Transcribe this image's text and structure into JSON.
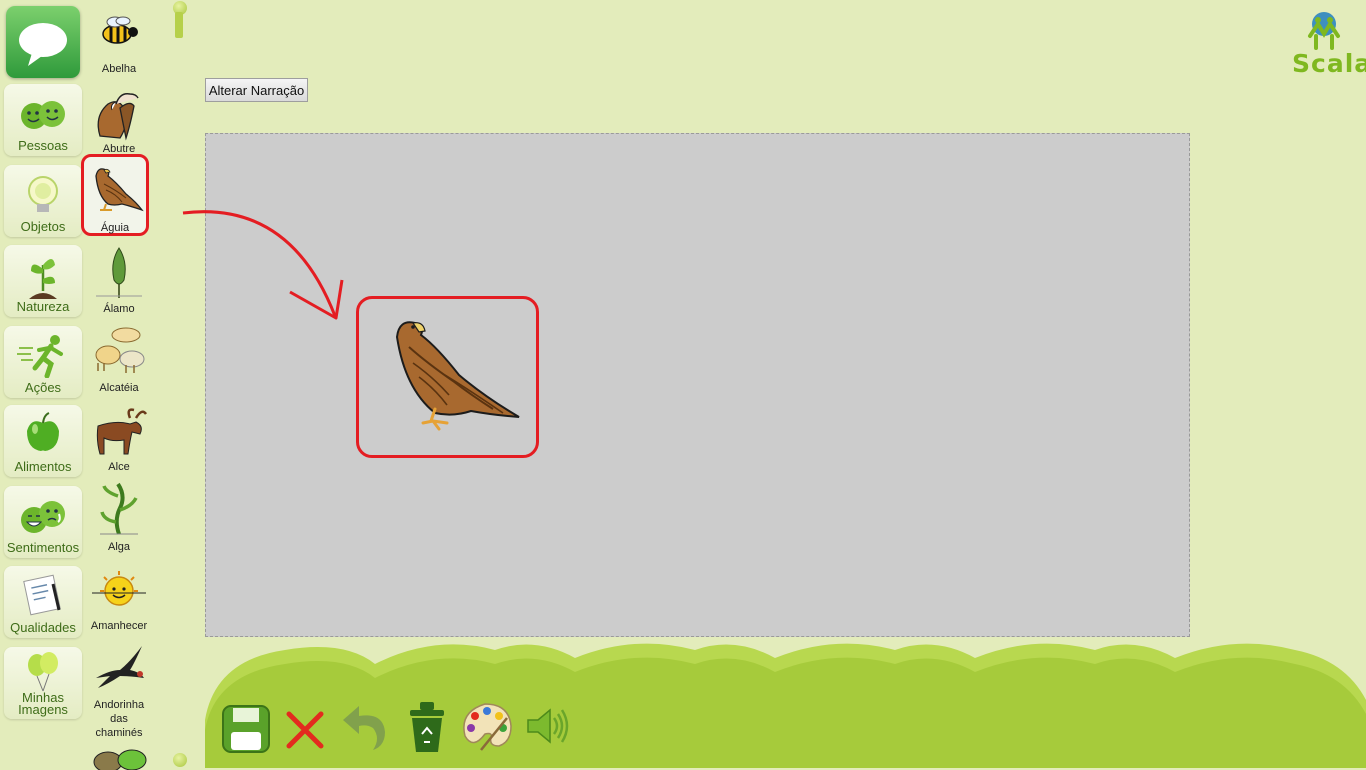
{
  "narration_button": "Alterar Narração",
  "logo_text": "Scala",
  "categories": [
    {
      "label": "Pessoas"
    },
    {
      "label": "Objetos"
    },
    {
      "label": "Natureza"
    },
    {
      "label": "Ações"
    },
    {
      "label": "Alimentos"
    },
    {
      "label": "Sentimentos"
    },
    {
      "label": "Qualidades"
    },
    {
      "label": "Minhas Imagens"
    }
  ],
  "symbols": [
    {
      "label": "Abelha"
    },
    {
      "label": "Abutre"
    },
    {
      "label": "Águia",
      "selected": true
    },
    {
      "label": "Álamo"
    },
    {
      "label": "Alcatéia"
    },
    {
      "label": "Alce"
    },
    {
      "label": "Alga"
    },
    {
      "label": "Amanhecer"
    },
    {
      "label": "Andorinha das chaminés"
    }
  ],
  "toolbar": {
    "icons": [
      "save-icon",
      "close-icon",
      "undo-icon",
      "trash-icon",
      "palette-icon",
      "speaker-icon"
    ]
  },
  "colors": {
    "background": "#e3ecbb",
    "canvas": "#cccccc",
    "highlight": "#e41d22",
    "category_text": "#3e6c18"
  }
}
